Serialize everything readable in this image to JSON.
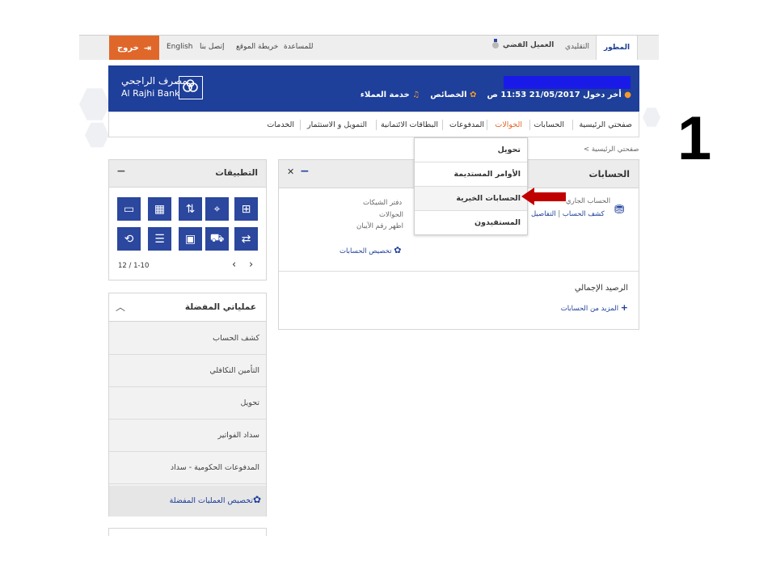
{
  "topbar": {
    "logout_label": "خروج",
    "links": [
      "English",
      "إتصل بنا",
      "خريطة الموقع",
      "للمساعدة"
    ],
    "silver_client": "العميل الفضي",
    "mode_tabs": {
      "classic": "التقليدي",
      "advanced": "المطور"
    }
  },
  "banner": {
    "logo_ar": "مصرف الراجحي",
    "logo_en": "Al Rajhi Bank",
    "last_login": "أخر دخول 21/05/2017 11:53 ص",
    "features": "الخصائص",
    "customer_service": "خدمة العملاء"
  },
  "nav": {
    "items": [
      "صفحتي الرئيسية",
      "الحسابات",
      "الحوالات",
      "المدفوعات",
      "البطاقات الائتمانية",
      "التمويل و الاستثمار",
      "الخدمات"
    ],
    "active_index": 2
  },
  "breadcrumb": "< صفحتي الرئيسية",
  "dropdown": {
    "items": [
      "تحويل",
      "الأوامر المستديمة",
      "الحسابات الخيرية",
      "المستفيدون"
    ],
    "highlight_index": 2
  },
  "apps": {
    "title": "التطبيقات",
    "pager": "12 / 1-10"
  },
  "favorites": {
    "title": "عملياتي المفضلة",
    "items": [
      "كشف الحساب",
      "التأمين التكافلي",
      "تحويل",
      "سداد الفواتير",
      "المدفوعات الحكومية - سداد"
    ],
    "customize": "تخصيص العمليات المفضلة"
  },
  "accounts": {
    "title": "الحسابات",
    "account_type": "الحساب الجاري",
    "details": "التفاصيل",
    "statement": "كشف الحساب",
    "side_links": [
      "دفتر الشيكات",
      "الحوالات",
      "اظهر رقم الآيبان"
    ],
    "customize": "تخصيص الحسابات",
    "total_balance": "الرصيد الإجمالي",
    "more_accounts": "المزيد من الحسابات"
  },
  "step_number": "1",
  "colors": {
    "brand_blue": "#1e3f9a",
    "orange": "#e0672a",
    "arrow_red": "#c00000"
  }
}
